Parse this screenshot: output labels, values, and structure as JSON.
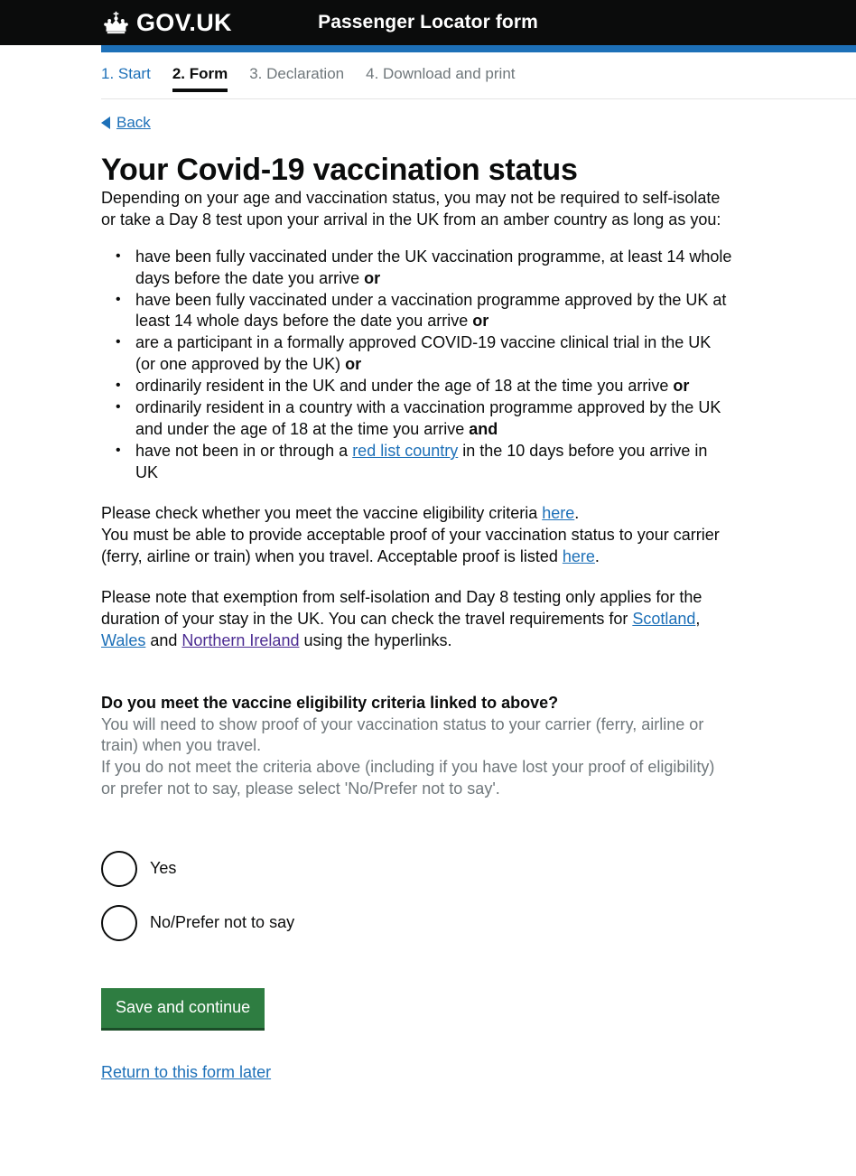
{
  "header": {
    "logotype": "GOV.UK",
    "crown_icon": "crown-icon",
    "service_name": "Passenger Locator form",
    "background": "#0b0c0c",
    "accent_bar_color": "#1d70b8"
  },
  "progress_tabs": [
    {
      "label": "1. Start",
      "state": "link"
    },
    {
      "label": "2. Form",
      "state": "active"
    },
    {
      "label": "3. Declaration",
      "state": "muted"
    },
    {
      "label": "4. Download and print",
      "state": "muted"
    }
  ],
  "back": {
    "label": "Back",
    "icon": "back-arrow-icon"
  },
  "page_title": "Your Covid-19 vaccination status",
  "intro_paragraph": "Depending on your age and vaccination status, you may not be required to self-isolate or take a Day 8 test upon your arrival in the UK from an amber country as long as you:",
  "criteria_list": [
    {
      "text_before": "have been fully vaccinated under the UK vaccination programme, at least 14 whole days before the date you arrive ",
      "emphasis": "or",
      "text_after": ""
    },
    {
      "text_before": "have been fully vaccinated under a vaccination programme approved by the UK at least 14 whole days before the date you arrive ",
      "emphasis": "or",
      "text_after": ""
    },
    {
      "text_before": "are a participant in a formally approved COVID-19 vaccine clinical trial in the UK (or one approved by the UK) ",
      "emphasis": "or",
      "text_after": ""
    },
    {
      "text_before": "ordinarily resident in the UK and under the age of 18 at the time you arrive ",
      "emphasis": "or",
      "text_after": ""
    },
    {
      "text_before": "ordinarily resident in a country with a vaccination programme approved by the UK and under the age of 18 at the time you arrive ",
      "emphasis": "and",
      "text_after": ""
    },
    {
      "text_before": "have not been in or through a ",
      "link": "red list country",
      "text_after": " in the 10 days before you arrive in UK"
    }
  ],
  "eligibility_paragraph": {
    "line1_before": "Please check whether you meet the vaccine eligibility criteria ",
    "line1_link": "here",
    "line1_after": ".",
    "line2_before": "You must be able to provide acceptable proof of your vaccination status to your carrier (ferry, airline or train) when you travel. Acceptable proof is listed ",
    "line2_link": "here",
    "line2_after": "."
  },
  "nations_paragraph": {
    "before": "Please note that exemption from self-isolation and Day 8 testing only applies for the duration of your stay in the UK. You can check the travel requirements for ",
    "link_scotland": "Scotland",
    "sep1": ", ",
    "link_wales": "Wales",
    "sep2": " and ",
    "link_northern_ireland": "Northern Ireland",
    "after": " using the hyperlinks."
  },
  "question": "Do you meet the vaccine eligibility criteria linked to above?",
  "hints": [
    "You will need to show proof of your vaccination status to your carrier (ferry, airline or train) when you travel.",
    "If you do not meet the criteria above (including if you have lost your proof of eligibility) or prefer not to say, please select 'No/Prefer not to say'."
  ],
  "radio_options": [
    {
      "label": "Yes",
      "checked": false
    },
    {
      "label": "No/Prefer not to say",
      "checked": false
    }
  ],
  "submit_button": "Save and continue",
  "return_link": "Return to this form later",
  "colors": {
    "link": "#1d70b8",
    "visited_link": "#4c2c92",
    "button_green": "#2e7d41",
    "muted_text": "#6f777b",
    "body_text": "#0b0c0c"
  }
}
